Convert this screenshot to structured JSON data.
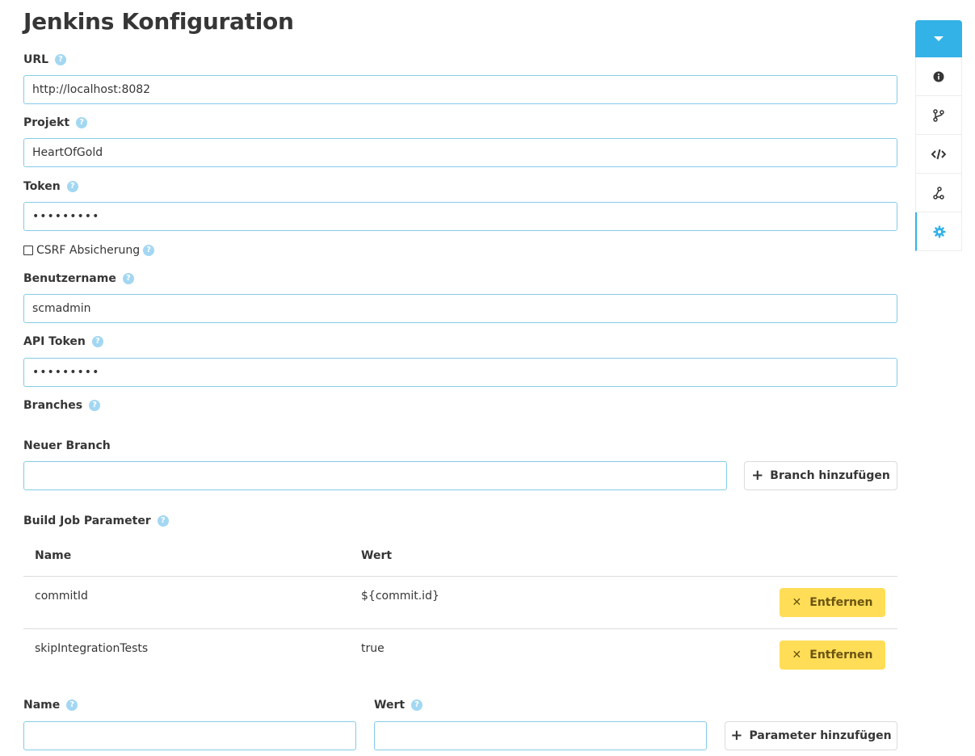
{
  "page": {
    "title": "Jenkins Konfiguration"
  },
  "fields": {
    "url": {
      "label": "URL",
      "value": "http://localhost:8082"
    },
    "project": {
      "label": "Projekt",
      "value": "HeartOfGold"
    },
    "token": {
      "label": "Token",
      "value": "•••••••••"
    },
    "csrf": {
      "label": "CSRF Absicherung",
      "checked": false
    },
    "username": {
      "label": "Benutzername",
      "value": "scmadmin"
    },
    "api_token": {
      "label": "API Token",
      "value": "•••••••••"
    }
  },
  "branches": {
    "label": "Branches",
    "new_branch_label": "Neuer Branch",
    "new_branch_value": "",
    "add_button": "Branch hinzufügen"
  },
  "parameters": {
    "label": "Build Job Parameter",
    "columns": [
      "Name",
      "Wert"
    ],
    "rows": [
      {
        "name": "commitId",
        "value": "${commit.id}",
        "remove_label": "Entfernen"
      },
      {
        "name": "skipIntegrationTests",
        "value": "true",
        "remove_label": "Entfernen"
      }
    ],
    "new_name_label": "Name",
    "new_value_label": "Wert",
    "new_name_value": "",
    "new_value_value": "",
    "add_button": "Parameter hinzufügen"
  },
  "help_glyph": "?",
  "sidenav": {
    "items": [
      "chevron-down-icon",
      "info-circle-icon",
      "code-branch-icon",
      "code-icon",
      "project-diagram-icon",
      "cog-icon"
    ],
    "active": "cog-icon",
    "accent_color": "#33b2e8"
  },
  "colors": {
    "input_border": "#86cbe8",
    "help_icon": "#a3d7f2",
    "warning_button": "#ffdd57"
  }
}
